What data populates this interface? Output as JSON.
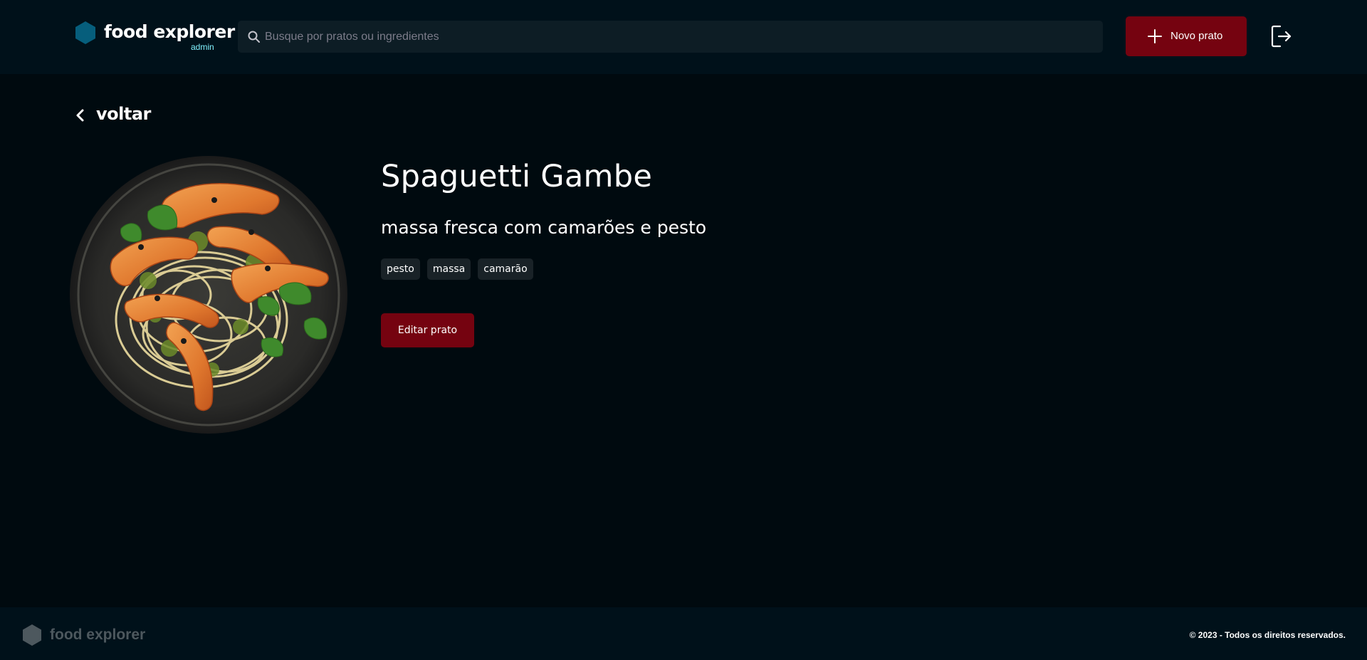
{
  "header": {
    "brand_name": "food explorer",
    "brand_role": "admin",
    "search_placeholder": "Busque por pratos ou ingredientes",
    "new_dish_label": "Novo prato"
  },
  "nav": {
    "back_label": "voltar"
  },
  "dish": {
    "name": "Spaguetti Gambe",
    "description": "massa fresca com camarões e pesto",
    "tags": [
      "pesto",
      "massa",
      "camarão"
    ],
    "edit_label": "Editar prato"
  },
  "footer": {
    "brand_name": "food explorer",
    "copyright": "© 2023 - Todos os direitos reservados."
  },
  "colors": {
    "background": "#000a0f",
    "header_bg": "#00111a",
    "accent_red": "#750310",
    "brand_hex": "#065e7c",
    "admin_label": "#82f3ff",
    "tag_bg": "#192227"
  },
  "icons": [
    "hexagon-logo-icon",
    "search-icon",
    "plus-icon",
    "sign-out-icon",
    "chevron-left-icon"
  ]
}
